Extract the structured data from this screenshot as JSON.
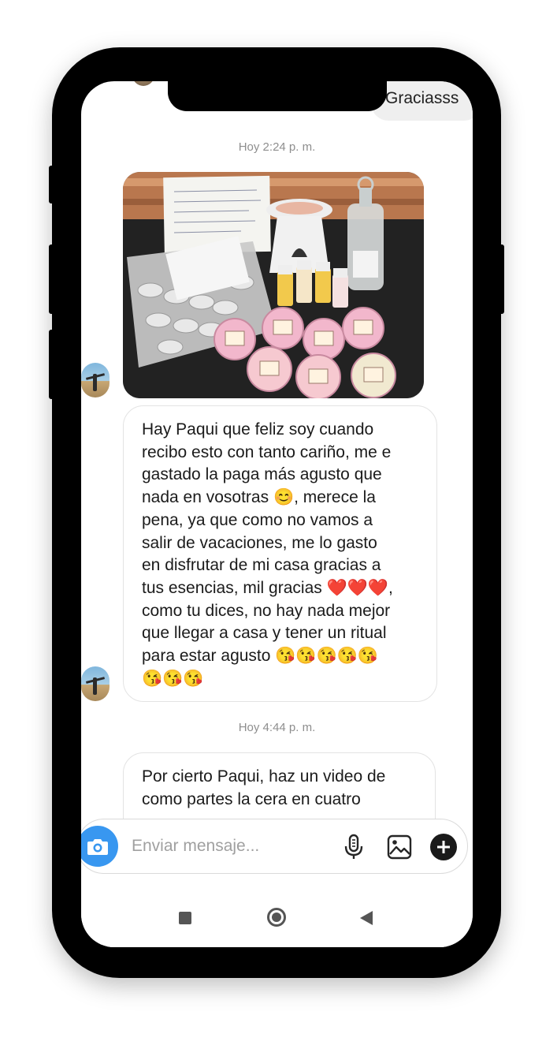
{
  "previous_message": {
    "text": "Graciasss"
  },
  "messages": [
    {
      "timestamp": "Hoy 2:24 p. m.",
      "type": "photo",
      "photo_description": "velas, quemador y ceras"
    },
    {
      "type": "text",
      "lines": [
        "Hay Paqui que feliz soy cuando",
        "recibo esto con tanto cariño, me e",
        "gastado la paga más agusto que",
        "nada en vosotras 😊, merece la",
        "pena, ya que como no vamos a",
        "salir de vacaciones, me lo gasto",
        "en disfrutar de mi casa gracias a",
        "tus esencias, mil gracias ❤️❤️❤️,",
        "como tu dices, no hay nada mejor",
        "que llegar a casa y tener un ritual",
        "para estar agusto 😘😘😘😘😘",
        "😘😘😘"
      ]
    },
    {
      "timestamp": "Hoy 4:44 p. m.",
      "type": "text",
      "lines": [
        "Por cierto Paqui, haz un video de",
        "como partes la cera en cuatro"
      ]
    }
  ],
  "composer": {
    "placeholder": "Enviar mensaje...",
    "icons": [
      "camera-icon",
      "microphone-icon",
      "gallery-icon",
      "plus-icon"
    ]
  },
  "navbar": {
    "icons": [
      "recents-icon",
      "home-icon",
      "back-icon"
    ]
  },
  "colors": {
    "camera_button": "#3897f0",
    "bubble_border": "#e3e3e3",
    "timestamp": "#8e8e8e"
  }
}
